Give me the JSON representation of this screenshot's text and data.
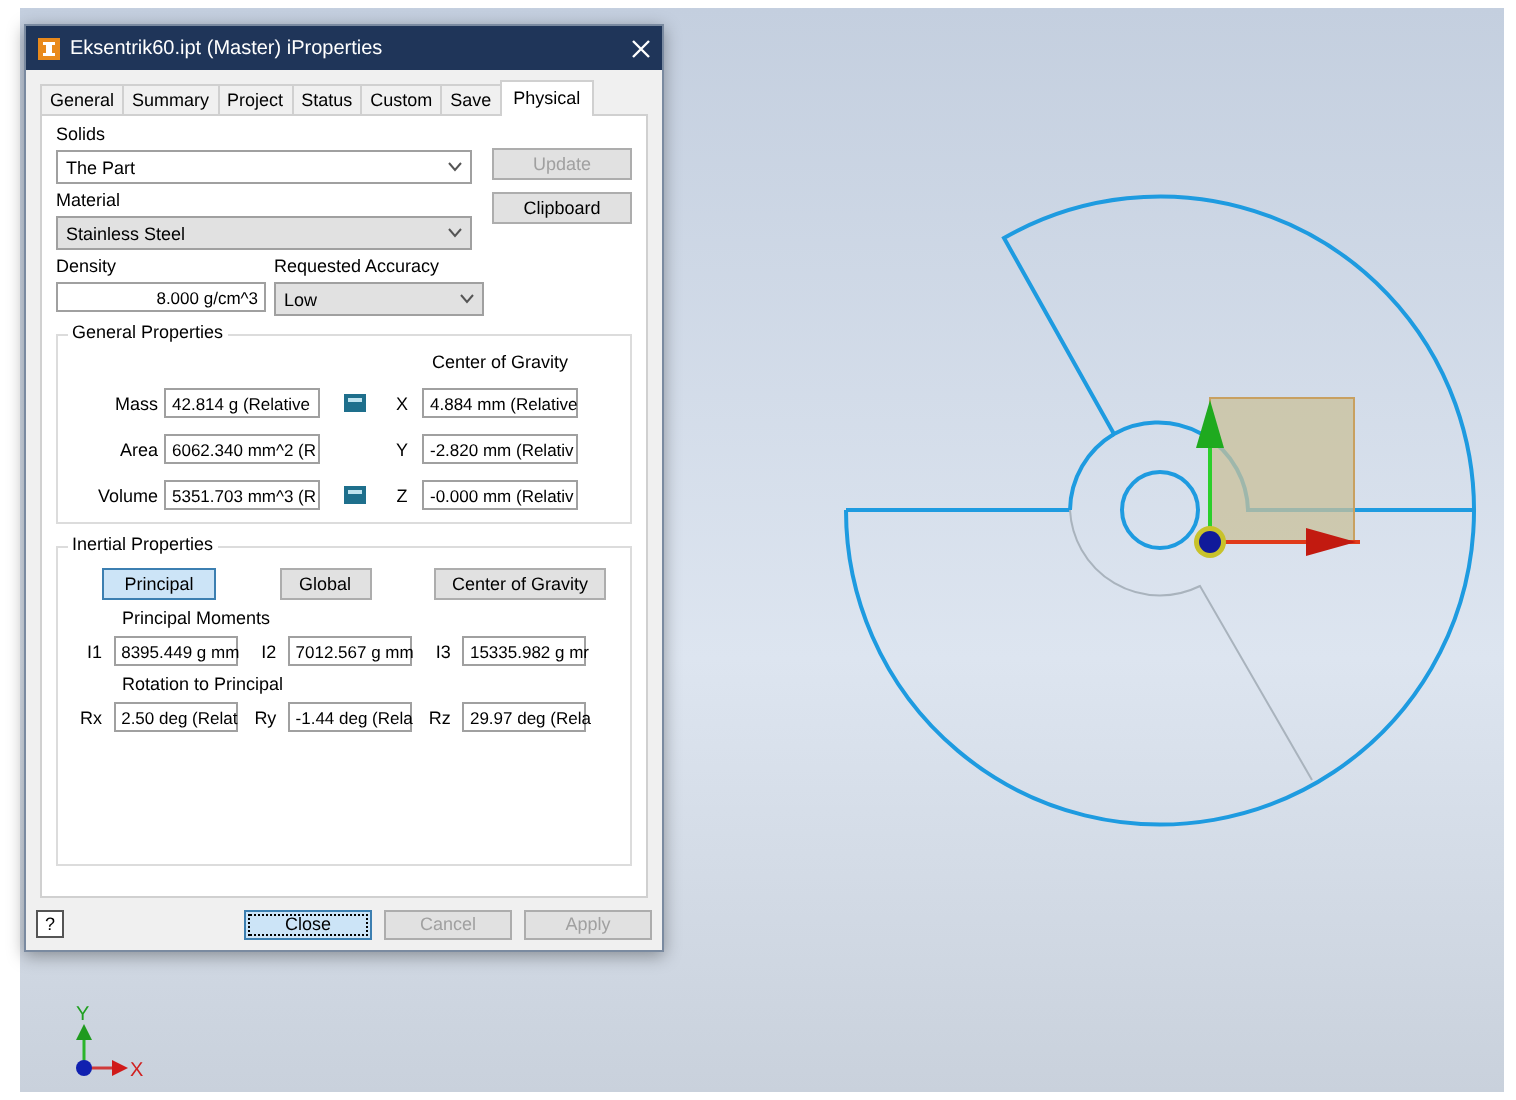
{
  "window": {
    "title": "Eksentrik60.ipt (Master) iProperties"
  },
  "tabs": [
    {
      "label": "General",
      "selected": false
    },
    {
      "label": "Summary",
      "selected": false
    },
    {
      "label": "Project",
      "selected": false
    },
    {
      "label": "Status",
      "selected": false
    },
    {
      "label": "Custom",
      "selected": false
    },
    {
      "label": "Save",
      "selected": false
    },
    {
      "label": "Physical",
      "selected": true
    }
  ],
  "solids": {
    "label": "Solids",
    "value": "The Part",
    "kind": "combo"
  },
  "material": {
    "label": "Material",
    "value": "Stainless Steel",
    "kind": "list"
  },
  "side_buttons": [
    {
      "label": "Update",
      "disabled": true
    },
    {
      "label": "Clipboard",
      "disabled": false
    }
  ],
  "density": {
    "label": "Density",
    "value": "8.000 g/cm^3"
  },
  "accuracy": {
    "label": "Requested Accuracy",
    "value": "Low",
    "kind": "list"
  },
  "general_properties": {
    "title": "General Properties",
    "cog_title": "Center of Gravity",
    "rows": [
      {
        "label": "Mass",
        "value": "42.814 g (Relative",
        "has_icon": true,
        "axis": "X",
        "cog": "4.884 mm (Relative"
      },
      {
        "label": "Area",
        "value": "6062.340 mm^2 (R",
        "has_icon": false,
        "axis": "Y",
        "cog": "-2.820 mm (Relativ"
      },
      {
        "label": "Volume",
        "value": "5351.703 mm^3 (R",
        "has_icon": true,
        "axis": "Z",
        "cog": "-0.000 mm (Relativ"
      }
    ]
  },
  "inertial_properties": {
    "title": "Inertial Properties",
    "buttons": [
      {
        "label": "Principal",
        "selected": true
      },
      {
        "label": "Global",
        "selected": false
      },
      {
        "label": "Center of Gravity",
        "selected": false
      }
    ],
    "moments_title": "Principal Moments",
    "moments": [
      {
        "label": "I1",
        "value": "8395.449 g mm"
      },
      {
        "label": "I2",
        "value": "7012.567 g mm"
      },
      {
        "label": "I3",
        "value": "15335.982 g mr"
      }
    ],
    "rotation_title": "Rotation to Principal",
    "rotations": [
      {
        "label": "Rx",
        "value": "2.50 deg (Relat"
      },
      {
        "label": "Ry",
        "value": "-1.44 deg (Rela"
      },
      {
        "label": "Rz",
        "value": "29.97 deg (Rela"
      }
    ]
  },
  "footer": {
    "help": "?",
    "buttons": [
      {
        "label": "Close",
        "disabled": false,
        "focused": true
      },
      {
        "label": "Cancel",
        "disabled": true,
        "focused": false
      },
      {
        "label": "Apply",
        "disabled": true,
        "focused": false
      }
    ]
  },
  "triad": {
    "x": "X",
    "y": "Y"
  }
}
